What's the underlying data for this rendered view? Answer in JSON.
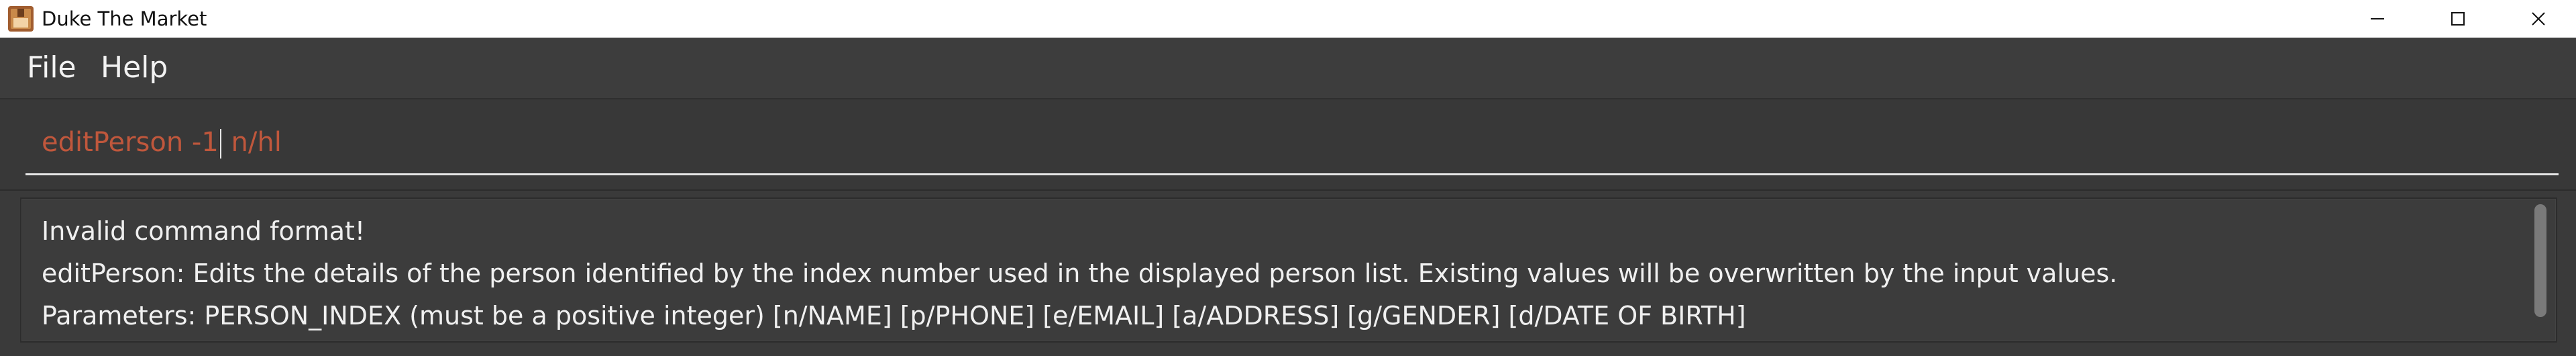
{
  "window": {
    "title": "Duke The Market",
    "controls": {
      "minimize": "minimize",
      "maximize": "maximize",
      "close": "close"
    }
  },
  "menu": {
    "items": [
      {
        "label": "File"
      },
      {
        "label": "Help"
      }
    ]
  },
  "command": {
    "before_caret": "editPerson -1",
    "after_caret": " n/hl",
    "text_color": "#c0573c"
  },
  "result": {
    "lines": [
      "Invalid command format!",
      "editPerson: Edits the details of the person identified by the index number used in the displayed person list. Existing values will be overwritten by the input values.",
      "Parameters: PERSON_INDEX (must be a positive integer) [n/NAME] [p/PHONE] [e/EMAIL] [a/ADDRESS] [g/GENDER] [d/DATE OF BIRTH]"
    ]
  },
  "icons": {
    "app": "duke-app-icon",
    "minimize": "minimize-icon",
    "maximize": "maximize-icon",
    "close": "close-icon"
  },
  "colors": {
    "background": "#3f3f3f",
    "title_bar": "#ffffff",
    "text": "#f0f0f0",
    "error_command": "#c0573c"
  }
}
